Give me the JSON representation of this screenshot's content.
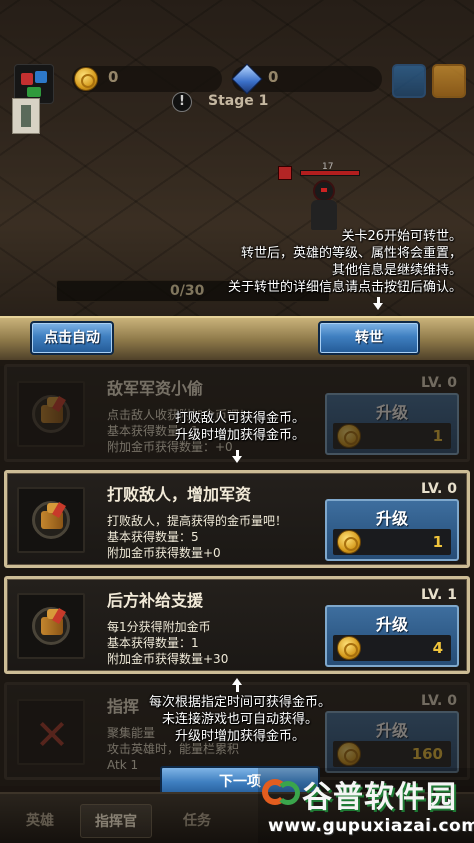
{
  "hud": {
    "gold": "0",
    "gems": "0",
    "stage_icon": "!",
    "stage": "Stage 1",
    "enemy_level": "17",
    "progress": "0/30"
  },
  "tooltips": {
    "rebirth": [
      "关卡26开始可转世。",
      "转世后，英雄的等级、属性将会重置，",
      "其他信息是继续维持。",
      "关于转世的详细信息请点击按钮后确认。"
    ],
    "first_card": [
      "打败敌人可获得金币。",
      "升级时增加获得金币。"
    ],
    "third_card": [
      "每次根据指定时间可获得金币。",
      "未连接游戏也可自动获得。",
      "升级时增加获得金币。"
    ]
  },
  "panel": {
    "auto_click_label": "点击自动",
    "rebirth_label": "转世"
  },
  "cards": [
    {
      "title": "敌军军资小偷",
      "level": "LV. 0",
      "desc": [
        "点击敌人收获附加金币吧！",
        "基本获得数量：1",
        "附加金币获得数量：+0"
      ],
      "upgrade_label": "升级",
      "cost": "1"
    },
    {
      "title": "打败敌人，增加军资",
      "level": "LV. 0",
      "desc": [
        "打败敌人，提高获得的金币量吧！",
        "基本获得数量：5",
        "附加金币获得数量+0"
      ],
      "upgrade_label": "升级",
      "cost": "1"
    },
    {
      "title": "后方补给支援",
      "level": "LV. 1",
      "desc": [
        "每1分获得附加金币",
        "基本获得数量：1",
        "附加金币获得数量+30"
      ],
      "upgrade_label": "升级",
      "cost": "4"
    },
    {
      "title": "指挥",
      "level": "LV. 0",
      "desc": [
        "聚集能量",
        "攻击英雄时，能量栏累积",
        "Atk 1"
      ],
      "upgrade_label": "升级",
      "cost": "160"
    }
  ],
  "next_label": "下一项",
  "tabs": [
    "英雄",
    "指挥官",
    "任务"
  ],
  "watermark": {
    "title": "谷普软件园",
    "url": "www.gupuxiazai.com"
  },
  "colors": {
    "accent_blue": "#3f7fc0",
    "gold_text": "#f0c43c",
    "card_border_active": "#cdbd96"
  }
}
